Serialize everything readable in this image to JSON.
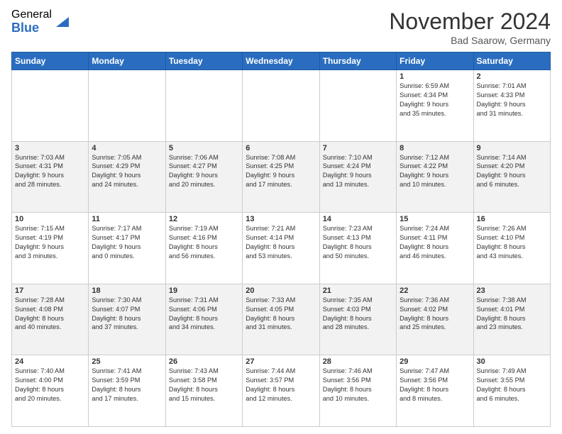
{
  "logo": {
    "general": "General",
    "blue": "Blue"
  },
  "title": "November 2024",
  "location": "Bad Saarow, Germany",
  "days_of_week": [
    "Sunday",
    "Monday",
    "Tuesday",
    "Wednesday",
    "Thursday",
    "Friday",
    "Saturday"
  ],
  "weeks": [
    [
      {
        "day": "",
        "info": ""
      },
      {
        "day": "",
        "info": ""
      },
      {
        "day": "",
        "info": ""
      },
      {
        "day": "",
        "info": ""
      },
      {
        "day": "",
        "info": ""
      },
      {
        "day": "1",
        "info": "Sunrise: 6:59 AM\nSunset: 4:34 PM\nDaylight: 9 hours\nand 35 minutes."
      },
      {
        "day": "2",
        "info": "Sunrise: 7:01 AM\nSunset: 4:33 PM\nDaylight: 9 hours\nand 31 minutes."
      }
    ],
    [
      {
        "day": "3",
        "info": "Sunrise: 7:03 AM\nSunset: 4:31 PM\nDaylight: 9 hours\nand 28 minutes."
      },
      {
        "day": "4",
        "info": "Sunrise: 7:05 AM\nSunset: 4:29 PM\nDaylight: 9 hours\nand 24 minutes."
      },
      {
        "day": "5",
        "info": "Sunrise: 7:06 AM\nSunset: 4:27 PM\nDaylight: 9 hours\nand 20 minutes."
      },
      {
        "day": "6",
        "info": "Sunrise: 7:08 AM\nSunset: 4:25 PM\nDaylight: 9 hours\nand 17 minutes."
      },
      {
        "day": "7",
        "info": "Sunrise: 7:10 AM\nSunset: 4:24 PM\nDaylight: 9 hours\nand 13 minutes."
      },
      {
        "day": "8",
        "info": "Sunrise: 7:12 AM\nSunset: 4:22 PM\nDaylight: 9 hours\nand 10 minutes."
      },
      {
        "day": "9",
        "info": "Sunrise: 7:14 AM\nSunset: 4:20 PM\nDaylight: 9 hours\nand 6 minutes."
      }
    ],
    [
      {
        "day": "10",
        "info": "Sunrise: 7:15 AM\nSunset: 4:19 PM\nDaylight: 9 hours\nand 3 minutes."
      },
      {
        "day": "11",
        "info": "Sunrise: 7:17 AM\nSunset: 4:17 PM\nDaylight: 9 hours\nand 0 minutes."
      },
      {
        "day": "12",
        "info": "Sunrise: 7:19 AM\nSunset: 4:16 PM\nDaylight: 8 hours\nand 56 minutes."
      },
      {
        "day": "13",
        "info": "Sunrise: 7:21 AM\nSunset: 4:14 PM\nDaylight: 8 hours\nand 53 minutes."
      },
      {
        "day": "14",
        "info": "Sunrise: 7:23 AM\nSunset: 4:13 PM\nDaylight: 8 hours\nand 50 minutes."
      },
      {
        "day": "15",
        "info": "Sunrise: 7:24 AM\nSunset: 4:11 PM\nDaylight: 8 hours\nand 46 minutes."
      },
      {
        "day": "16",
        "info": "Sunrise: 7:26 AM\nSunset: 4:10 PM\nDaylight: 8 hours\nand 43 minutes."
      }
    ],
    [
      {
        "day": "17",
        "info": "Sunrise: 7:28 AM\nSunset: 4:08 PM\nDaylight: 8 hours\nand 40 minutes."
      },
      {
        "day": "18",
        "info": "Sunrise: 7:30 AM\nSunset: 4:07 PM\nDaylight: 8 hours\nand 37 minutes."
      },
      {
        "day": "19",
        "info": "Sunrise: 7:31 AM\nSunset: 4:06 PM\nDaylight: 8 hours\nand 34 minutes."
      },
      {
        "day": "20",
        "info": "Sunrise: 7:33 AM\nSunset: 4:05 PM\nDaylight: 8 hours\nand 31 minutes."
      },
      {
        "day": "21",
        "info": "Sunrise: 7:35 AM\nSunset: 4:03 PM\nDaylight: 8 hours\nand 28 minutes."
      },
      {
        "day": "22",
        "info": "Sunrise: 7:36 AM\nSunset: 4:02 PM\nDaylight: 8 hours\nand 25 minutes."
      },
      {
        "day": "23",
        "info": "Sunrise: 7:38 AM\nSunset: 4:01 PM\nDaylight: 8 hours\nand 23 minutes."
      }
    ],
    [
      {
        "day": "24",
        "info": "Sunrise: 7:40 AM\nSunset: 4:00 PM\nDaylight: 8 hours\nand 20 minutes."
      },
      {
        "day": "25",
        "info": "Sunrise: 7:41 AM\nSunset: 3:59 PM\nDaylight: 8 hours\nand 17 minutes."
      },
      {
        "day": "26",
        "info": "Sunrise: 7:43 AM\nSunset: 3:58 PM\nDaylight: 8 hours\nand 15 minutes."
      },
      {
        "day": "27",
        "info": "Sunrise: 7:44 AM\nSunset: 3:57 PM\nDaylight: 8 hours\nand 12 minutes."
      },
      {
        "day": "28",
        "info": "Sunrise: 7:46 AM\nSunset: 3:56 PM\nDaylight: 8 hours\nand 10 minutes."
      },
      {
        "day": "29",
        "info": "Sunrise: 7:47 AM\nSunset: 3:56 PM\nDaylight: 8 hours\nand 8 minutes."
      },
      {
        "day": "30",
        "info": "Sunrise: 7:49 AM\nSunset: 3:55 PM\nDaylight: 8 hours\nand 6 minutes."
      }
    ]
  ]
}
